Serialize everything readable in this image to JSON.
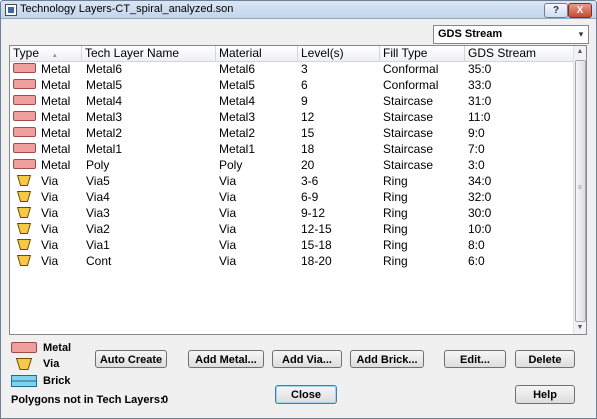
{
  "window": {
    "title": "Technology Layers-CT_spiral_analyzed.son",
    "help_glyph": "?",
    "close_glyph": "X"
  },
  "stream_selector": {
    "value": "GDS Stream",
    "arrow": "▾"
  },
  "table": {
    "columns": [
      "Type",
      "Tech Layer Name",
      "Material",
      "Level(s)",
      "Fill Type",
      "GDS Stream"
    ],
    "sort_glyph": "▴",
    "rows": [
      {
        "type": "Metal",
        "icon": "metal",
        "name": "Metal6",
        "material": "Metal6",
        "levels": "3",
        "fill": "Conformal",
        "gds": "35:0"
      },
      {
        "type": "Metal",
        "icon": "metal",
        "name": "Metal5",
        "material": "Metal5",
        "levels": "6",
        "fill": "Conformal",
        "gds": "33:0"
      },
      {
        "type": "Metal",
        "icon": "metal",
        "name": "Metal4",
        "material": "Metal4",
        "levels": "9",
        "fill": "Staircase",
        "gds": "31:0"
      },
      {
        "type": "Metal",
        "icon": "metal",
        "name": "Metal3",
        "material": "Metal3",
        "levels": "12",
        "fill": "Staircase",
        "gds": "11:0"
      },
      {
        "type": "Metal",
        "icon": "metal",
        "name": "Metal2",
        "material": "Metal2",
        "levels": "15",
        "fill": "Staircase",
        "gds": "9:0"
      },
      {
        "type": "Metal",
        "icon": "metal",
        "name": "Metal1",
        "material": "Metal1",
        "levels": "18",
        "fill": "Staircase",
        "gds": "7:0"
      },
      {
        "type": "Metal",
        "icon": "metal",
        "name": "Poly",
        "material": "Poly",
        "levels": "20",
        "fill": "Staircase",
        "gds": "3:0"
      },
      {
        "type": "Via",
        "icon": "via",
        "name": "Via5",
        "material": "Via",
        "levels": "3-6",
        "fill": "Ring",
        "gds": "34:0"
      },
      {
        "type": "Via",
        "icon": "via",
        "name": "Via4",
        "material": "Via",
        "levels": "6-9",
        "fill": "Ring",
        "gds": "32:0"
      },
      {
        "type": "Via",
        "icon": "via",
        "name": "Via3",
        "material": "Via",
        "levels": "9-12",
        "fill": "Ring",
        "gds": "30:0"
      },
      {
        "type": "Via",
        "icon": "via",
        "name": "Via2",
        "material": "Via",
        "levels": "12-15",
        "fill": "Ring",
        "gds": "10:0"
      },
      {
        "type": "Via",
        "icon": "via",
        "name": "Via1",
        "material": "Via",
        "levels": "15-18",
        "fill": "Ring",
        "gds": "8:0"
      },
      {
        "type": "Via",
        "icon": "via",
        "name": "Cont",
        "material": "Via",
        "levels": "18-20",
        "fill": "Ring",
        "gds": "6:0"
      }
    ],
    "scrollbar": {
      "up": "▲",
      "down": "▼",
      "grip": "≡"
    }
  },
  "legend": [
    {
      "label": "Metal",
      "icon": "metal-swatch-icon"
    },
    {
      "label": "Via",
      "icon": "via-swatch-icon"
    },
    {
      "label": "Brick",
      "icon": "brick-swatch-icon"
    }
  ],
  "buttons": {
    "auto_create": "Auto Create",
    "add_metal": "Add Metal...",
    "add_via": "Add Via...",
    "add_brick": "Add Brick...",
    "edit": "Edit...",
    "delete": "Delete",
    "close": "Close",
    "help": "Help"
  },
  "status": {
    "label": "Polygons not in Tech Layers:",
    "value": "0"
  },
  "colors": {
    "metal_fill": "#ef9f9d",
    "metal_border": "#9e4b49",
    "via_fill": "#f5c84a",
    "via_border": "#6b5200",
    "brick_fill": "#7fd3ef",
    "brick_border": "#1f6e8c"
  }
}
